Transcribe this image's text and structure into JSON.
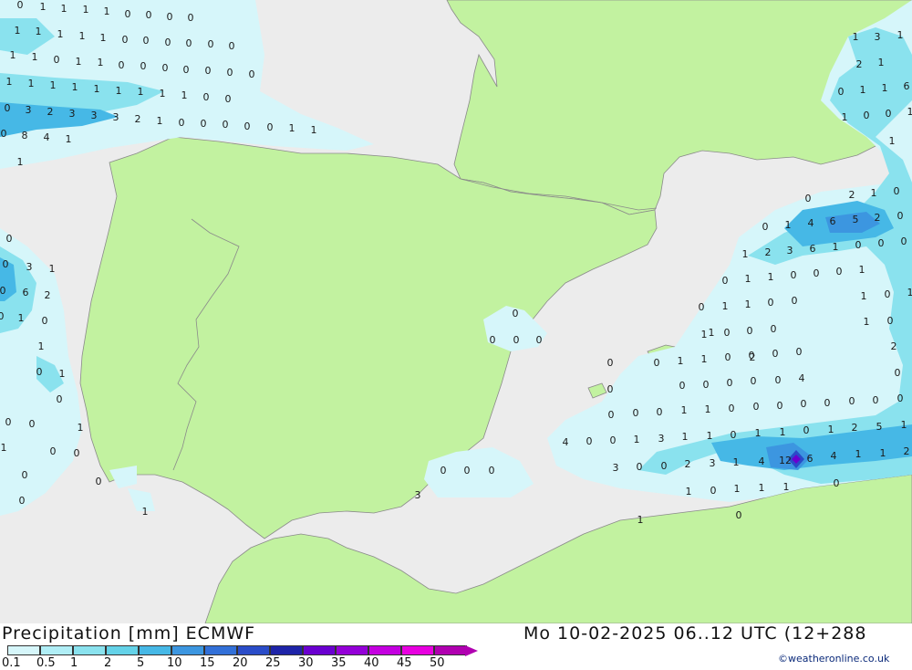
{
  "title": {
    "left": "Precipitation [mm] ECMWF",
    "right": "Mo 10-02-2025 06..12 UTC (12+288"
  },
  "credit": "©weatheronline.co.uk",
  "legend": {
    "ticks": [
      "0.1",
      "0.5",
      "1",
      "2",
      "5",
      "10",
      "15",
      "20",
      "25",
      "30",
      "35",
      "40",
      "45",
      "50"
    ],
    "colors": [
      "#d6f6fa",
      "#b0eef6",
      "#8ae2ee",
      "#64d2e8",
      "#46b8e6",
      "#3c96e0",
      "#3270d8",
      "#2a4cc8",
      "#1e24a8",
      "#6a00d0",
      "#9400d8",
      "#c400e0",
      "#e800e0",
      "#b000b0"
    ]
  },
  "map_colors": {
    "sea": "#ececec",
    "land": "#c2f2a0",
    "border": "#8a8a8a"
  },
  "precip_labels": [
    {
      "id": "r0",
      "text": "0"
    },
    {
      "id": "r1",
      "text": "1"
    },
    {
      "id": "r2",
      "text": "1"
    },
    {
      "id": "r3",
      "text": "1"
    },
    {
      "id": "r4",
      "text": "1"
    },
    {
      "id": "r5",
      "text": "0"
    },
    {
      "id": "r6",
      "text": "0"
    },
    {
      "id": "r7",
      "text": "0"
    },
    {
      "id": "r8",
      "text": "0"
    },
    {
      "id": "r9",
      "text": "1"
    },
    {
      "id": "r10",
      "text": "1"
    },
    {
      "id": "r11",
      "text": "1"
    },
    {
      "id": "r12",
      "text": "1"
    },
    {
      "id": "r13",
      "text": "1"
    },
    {
      "id": "r14",
      "text": "0"
    },
    {
      "id": "r15",
      "text": "0"
    },
    {
      "id": "r16",
      "text": "0"
    },
    {
      "id": "r17",
      "text": "0"
    },
    {
      "id": "r18",
      "text": "0"
    },
    {
      "id": "r19",
      "text": "0"
    },
    {
      "id": "r20",
      "text": "1"
    },
    {
      "id": "r21",
      "text": "1"
    },
    {
      "id": "r22",
      "text": "0"
    },
    {
      "id": "r23",
      "text": "1"
    },
    {
      "id": "r24",
      "text": "1"
    },
    {
      "id": "r25",
      "text": "0"
    },
    {
      "id": "r26",
      "text": "0"
    },
    {
      "id": "r27",
      "text": "0"
    },
    {
      "id": "r28",
      "text": "0"
    },
    {
      "id": "r29",
      "text": "0"
    },
    {
      "id": "r30",
      "text": "0"
    },
    {
      "id": "r31",
      "text": "0"
    },
    {
      "id": "r32",
      "text": "1"
    },
    {
      "id": "r33",
      "text": "1"
    },
    {
      "id": "r34",
      "text": "1"
    },
    {
      "id": "r35",
      "text": "1"
    },
    {
      "id": "r36",
      "text": "1"
    },
    {
      "id": "r37",
      "text": "1"
    },
    {
      "id": "r38",
      "text": "1"
    },
    {
      "id": "r39",
      "text": "1"
    },
    {
      "id": "r40",
      "text": "1"
    },
    {
      "id": "r41",
      "text": "0"
    },
    {
      "id": "r42",
      "text": "0"
    },
    {
      "id": "r43",
      "text": "0"
    },
    {
      "id": "r44",
      "text": "3"
    },
    {
      "id": "r45",
      "text": "2"
    },
    {
      "id": "r46",
      "text": "3"
    },
    {
      "id": "r47",
      "text": "3"
    },
    {
      "id": "r48",
      "text": "3"
    },
    {
      "id": "r49",
      "text": "2"
    },
    {
      "id": "r50",
      "text": "1"
    },
    {
      "id": "r51",
      "text": "0"
    },
    {
      "id": "r52",
      "text": "0"
    },
    {
      "id": "r53",
      "text": "0"
    },
    {
      "id": "r54",
      "text": "0"
    },
    {
      "id": "r55",
      "text": "0"
    },
    {
      "id": "r56",
      "text": "1"
    },
    {
      "id": "r57",
      "text": "1"
    },
    {
      "id": "r58",
      "text": "0"
    },
    {
      "id": "r59",
      "text": "8"
    },
    {
      "id": "r60",
      "text": "4"
    },
    {
      "id": "r61",
      "text": "1"
    },
    {
      "id": "r62",
      "text": "1"
    },
    {
      "id": "r63",
      "text": "0"
    },
    {
      "id": "r64",
      "text": "0"
    },
    {
      "id": "r65",
      "text": "3"
    },
    {
      "id": "r66",
      "text": "1"
    },
    {
      "id": "r67",
      "text": "0"
    },
    {
      "id": "r68",
      "text": "6"
    },
    {
      "id": "r69",
      "text": "2"
    },
    {
      "id": "r70",
      "text": "0"
    },
    {
      "id": "r71",
      "text": "1"
    },
    {
      "id": "r72",
      "text": "0"
    },
    {
      "id": "r73",
      "text": "1"
    },
    {
      "id": "r74",
      "text": "0"
    },
    {
      "id": "r75",
      "text": "1"
    },
    {
      "id": "r76",
      "text": "0"
    },
    {
      "id": "r77",
      "text": "0"
    },
    {
      "id": "r78",
      "text": "0"
    },
    {
      "id": "r79",
      "text": "1"
    },
    {
      "id": "r80",
      "text": "1"
    },
    {
      "id": "r81",
      "text": "0"
    },
    {
      "id": "r82",
      "text": "0"
    },
    {
      "id": "r83",
      "text": "0"
    },
    {
      "id": "r84",
      "text": "0"
    },
    {
      "id": "s0",
      "text": "0"
    },
    {
      "id": "s1",
      "text": "0"
    },
    {
      "id": "s2",
      "text": "0"
    },
    {
      "id": "s3",
      "text": "0"
    },
    {
      "id": "s4",
      "text": "0"
    },
    {
      "id": "s5",
      "text": "0"
    },
    {
      "id": "s6",
      "text": "0"
    },
    {
      "id": "e0",
      "text": "1"
    },
    {
      "id": "e1",
      "text": "3"
    },
    {
      "id": "e2",
      "text": "1"
    },
    {
      "id": "e3",
      "text": "2"
    },
    {
      "id": "e4",
      "text": "1"
    },
    {
      "id": "e5",
      "text": "0"
    },
    {
      "id": "e6",
      "text": "1"
    },
    {
      "id": "e7",
      "text": "1"
    },
    {
      "id": "e8",
      "text": "6"
    },
    {
      "id": "e9",
      "text": "1"
    },
    {
      "id": "e10",
      "text": "0"
    },
    {
      "id": "e11",
      "text": "0"
    },
    {
      "id": "e12",
      "text": "1"
    },
    {
      "id": "e13",
      "text": "1"
    },
    {
      "id": "e14",
      "text": "0"
    },
    {
      "id": "e15",
      "text": "2"
    },
    {
      "id": "e16",
      "text": "1"
    },
    {
      "id": "e17",
      "text": "0"
    },
    {
      "id": "e18",
      "text": "0"
    },
    {
      "id": "e19",
      "text": "1"
    },
    {
      "id": "e20",
      "text": "4"
    },
    {
      "id": "e21",
      "text": "6"
    },
    {
      "id": "e22",
      "text": "5"
    },
    {
      "id": "e23",
      "text": "2"
    },
    {
      "id": "e24",
      "text": "0"
    },
    {
      "id": "e25",
      "text": "1"
    },
    {
      "id": "e26",
      "text": "2"
    },
    {
      "id": "e27",
      "text": "3"
    },
    {
      "id": "e28",
      "text": "6"
    },
    {
      "id": "e29",
      "text": "1"
    },
    {
      "id": "e30",
      "text": "0"
    },
    {
      "id": "e31",
      "text": "0"
    },
    {
      "id": "e32",
      "text": "0"
    },
    {
      "id": "e33",
      "text": "0"
    },
    {
      "id": "e34",
      "text": "1"
    },
    {
      "id": "e35",
      "text": "1"
    },
    {
      "id": "e36",
      "text": "0"
    },
    {
      "id": "e37",
      "text": "0"
    },
    {
      "id": "e38",
      "text": "0"
    },
    {
      "id": "e39",
      "text": "1"
    },
    {
      "id": "e40",
      "text": "0"
    },
    {
      "id": "e41",
      "text": "1"
    },
    {
      "id": "e42",
      "text": "1"
    },
    {
      "id": "e43",
      "text": "0"
    },
    {
      "id": "e44",
      "text": "0"
    },
    {
      "id": "e45",
      "text": "1"
    },
    {
      "id": "e46",
      "text": "0"
    },
    {
      "id": "e47",
      "text": "1"
    },
    {
      "id": "e48",
      "text": "1"
    },
    {
      "id": "e49",
      "text": "0"
    },
    {
      "id": "e50",
      "text": "0"
    },
    {
      "id": "e51",
      "text": "0"
    },
    {
      "id": "e52",
      "text": "1"
    },
    {
      "id": "e53",
      "text": "0"
    },
    {
      "id": "e54",
      "text": "0"
    },
    {
      "id": "e55",
      "text": "1"
    },
    {
      "id": "e56",
      "text": "1"
    },
    {
      "id": "e57",
      "text": "0"
    },
    {
      "id": "e58",
      "text": "0"
    },
    {
      "id": "e59",
      "text": "0"
    },
    {
      "id": "e60",
      "text": "0"
    },
    {
      "id": "e61",
      "text": "2"
    },
    {
      "id": "e62",
      "text": "0"
    },
    {
      "id": "e63",
      "text": "0"
    },
    {
      "id": "e64",
      "text": "0"
    },
    {
      "id": "e65",
      "text": "0"
    },
    {
      "id": "e66",
      "text": "0"
    },
    {
      "id": "e67",
      "text": "0"
    },
    {
      "id": "e68",
      "text": "0"
    },
    {
      "id": "e69",
      "text": "4"
    },
    {
      "id": "e70",
      "text": "0"
    },
    {
      "id": "e71",
      "text": "0"
    },
    {
      "id": "e72",
      "text": "0"
    },
    {
      "id": "e73",
      "text": "0"
    },
    {
      "id": "e74",
      "text": "1"
    },
    {
      "id": "e75",
      "text": "1"
    },
    {
      "id": "e76",
      "text": "0"
    },
    {
      "id": "e77",
      "text": "0"
    },
    {
      "id": "e78",
      "text": "0"
    },
    {
      "id": "e79",
      "text": "0"
    },
    {
      "id": "e80",
      "text": "0"
    },
    {
      "id": "e81",
      "text": "0"
    },
    {
      "id": "e82",
      "text": "0"
    },
    {
      "id": "e83",
      "text": "0"
    },
    {
      "id": "e84",
      "text": "4"
    },
    {
      "id": "e85",
      "text": "0"
    },
    {
      "id": "e86",
      "text": "0"
    },
    {
      "id": "e87",
      "text": "1"
    },
    {
      "id": "e88",
      "text": "3"
    },
    {
      "id": "e89",
      "text": "1"
    },
    {
      "id": "e90",
      "text": "1"
    },
    {
      "id": "e91",
      "text": "0"
    },
    {
      "id": "e92",
      "text": "1"
    },
    {
      "id": "e93",
      "text": "1"
    },
    {
      "id": "e94",
      "text": "0"
    },
    {
      "id": "e95",
      "text": "1"
    },
    {
      "id": "e96",
      "text": "2"
    },
    {
      "id": "e97",
      "text": "5"
    },
    {
      "id": "e98",
      "text": "1"
    },
    {
      "id": "e99",
      "text": "3"
    },
    {
      "id": "e100",
      "text": "0"
    },
    {
      "id": "e101",
      "text": "0"
    },
    {
      "id": "e102",
      "text": "2"
    },
    {
      "id": "e103",
      "text": "3"
    },
    {
      "id": "e104",
      "text": "1"
    },
    {
      "id": "e105",
      "text": "4"
    },
    {
      "id": "e106",
      "text": "12"
    },
    {
      "id": "e107",
      "text": "6"
    },
    {
      "id": "e108",
      "text": "4"
    },
    {
      "id": "e109",
      "text": "1"
    },
    {
      "id": "e110",
      "text": "1"
    },
    {
      "id": "e111",
      "text": "2"
    },
    {
      "id": "e112",
      "text": "1"
    },
    {
      "id": "e113",
      "text": "0"
    },
    {
      "id": "e114",
      "text": "1"
    },
    {
      "id": "e115",
      "text": "1"
    },
    {
      "id": "e116",
      "text": "1"
    },
    {
      "id": "e117",
      "text": "0"
    },
    {
      "id": "e118",
      "text": "1"
    },
    {
      "id": "e119",
      "text": "0"
    },
    {
      "id": "e120",
      "text": "0"
    },
    {
      "id": "e121",
      "text": "1"
    },
    {
      "id": "e122",
      "text": "3"
    },
    {
      "id": "e123",
      "text": "1"
    },
    {
      "id": "e124",
      "text": "2"
    },
    {
      "id": "e125",
      "text": "1"
    },
    {
      "id": "e126",
      "text": "6"
    },
    {
      "id": "e127",
      "text": "0"
    },
    {
      "id": "e128",
      "text": "1"
    },
    {
      "id": "e129",
      "text": "1"
    },
    {
      "id": "e130",
      "text": "0"
    },
    {
      "id": "e131",
      "text": "1"
    },
    {
      "id": "e132",
      "text": "1"
    },
    {
      "id": "e133",
      "text": "3"
    },
    {
      "id": "e134",
      "text": "0"
    },
    {
      "id": "e135",
      "text": "1"
    },
    {
      "id": "e136",
      "text": "0"
    },
    {
      "id": "e137",
      "text": "1"
    },
    {
      "id": "e138",
      "text": "0"
    },
    {
      "id": "e139",
      "text": "0"
    },
    {
      "id": "e140",
      "text": "0"
    },
    {
      "id": "e141",
      "text": "0"
    },
    {
      "id": "e142",
      "text": "4"
    },
    {
      "id": "e143",
      "text": "0"
    },
    {
      "id": "e144",
      "text": "0"
    }
  ]
}
